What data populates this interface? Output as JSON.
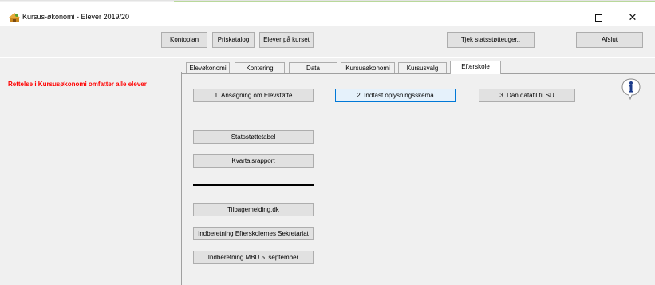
{
  "window": {
    "title": "Kursus-økonomi - Elever 2019/20",
    "controls": {
      "minimize": "–",
      "close": "✕"
    }
  },
  "toolbar": {
    "kontoplan": "Kontoplan",
    "priskatalog": "Priskatalog",
    "elever_paa_kurset": "Elever på kurset",
    "tjek_statsstotte": "Tjek statsstøtteuger..",
    "afslut": "Afslut"
  },
  "left_pane": {
    "warning": "Rettelse i Kursusøkonomi omfatter alle elever",
    "warning_color": "#ff0000"
  },
  "tabs": [
    {
      "label": "Elevøkonomi",
      "active": false
    },
    {
      "label": "Kontering",
      "active": false
    },
    {
      "label": "Data",
      "active": false
    },
    {
      "label": "Kursusøkonomi",
      "active": false
    },
    {
      "label": "Kursusvalg",
      "active": false
    },
    {
      "label": "Efterskole",
      "active": true
    }
  ],
  "content": {
    "ansoegning": "1. Ansøgning om Elevstøtte",
    "indtast": "2. Indtast oplysningsskema",
    "dan_datafil": "3. Dan datafil til SU",
    "statsstoettetabel": "Statsstøttetabel",
    "kvartalsrapport": "Kvartalsrapport",
    "tilbagemelding": "Tilbagemelding.dk",
    "indberetning_efterskoler": "Indberetning Efterskolernes Sekretariat",
    "indberetning_mbu": "Indberetning MBU 5. september"
  },
  "icons": {
    "app": "app-icon",
    "info": "info-icon"
  },
  "colors": {
    "focus_border": "#0078d7",
    "focus_fill": "#e5f1fb"
  }
}
